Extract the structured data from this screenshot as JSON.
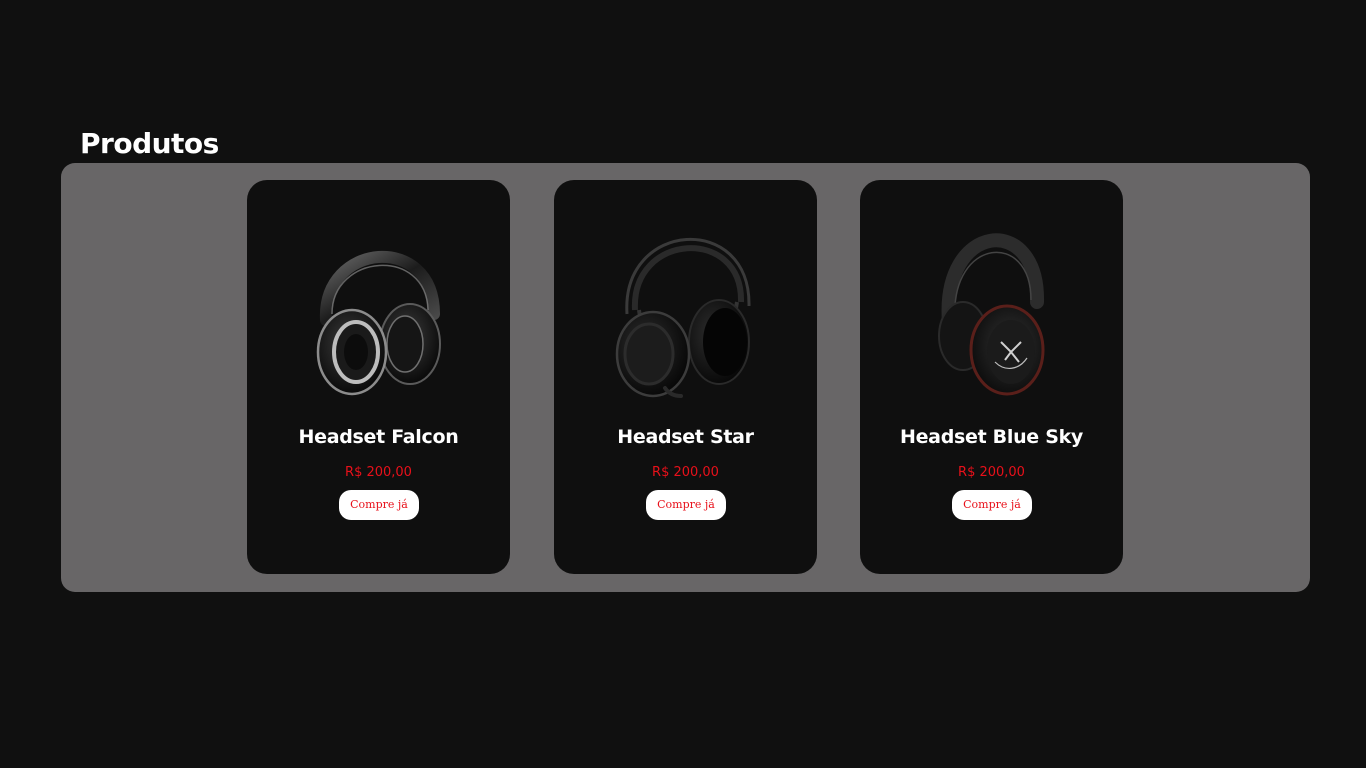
{
  "section": {
    "title": "Produtos"
  },
  "colors": {
    "page_background": "#101010",
    "panel_background": "#686667",
    "card_background": "#0f0f0f",
    "price_color": "#e8101a",
    "button_background": "#ffffff"
  },
  "products": [
    {
      "name": "Headset Falcon",
      "price": "R$ 200,00",
      "button_label": "Compre já",
      "image_icon": "headset-falcon-image"
    },
    {
      "name": "Headset Star",
      "price": "R$ 200,00",
      "button_label": "Compre já",
      "image_icon": "headset-star-image"
    },
    {
      "name": "Headset Blue Sky",
      "price": "R$ 200,00",
      "button_label": "Compre já",
      "image_icon": "headset-blue-sky-image"
    }
  ]
}
